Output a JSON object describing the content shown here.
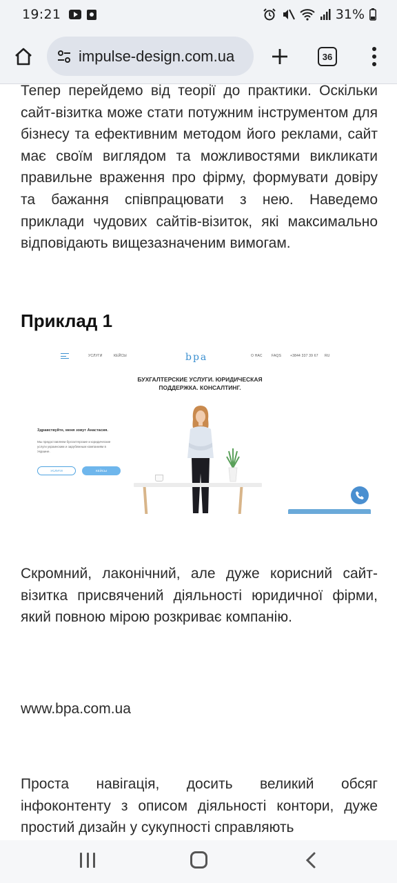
{
  "status_bar": {
    "time": "19:21",
    "battery": "31%"
  },
  "browser": {
    "url": "impulse-design.com.ua",
    "tab_count": "36"
  },
  "article": {
    "paragraph_intro": "Тепер перейдемо від теорії до практики. Оскільки сайт-візитка може стати потужним інструментом для бізнесу та ефективним методом його реклами, сайт має своїм виглядом та можливостями викликати правильне враження про фірму, формувати довіру та бажання співпрацювати з нею. Наведемо приклади чудових сайтів-візиток, які максимально відповідають вищезазначеним вимогам.",
    "heading": "Приклад 1",
    "example_shot": {
      "nav_services": "УСЛУГИ",
      "nav_cases": "КЕЙСЫ",
      "logo": "bpa",
      "nav_about": "О НАС",
      "nav_faqs": "FAQS",
      "phone": "+3844 337 39 67",
      "lang": "RU",
      "title": "БУХГАЛТЕРСКИЕ УСЛУГИ. ЮРИДИЧЕСКАЯ ПОДДЕРЖКА. КОНСАЛТИНГ.",
      "greeting": "Здравствуйте, меня зовут Анастасия.",
      "description": "Мы предоставляем бухгалтерские и юридические услуги украинским и зарубежным компаниям в Украине.",
      "button_services": "УСЛУГИ",
      "button_cases": "КЕЙСЫ"
    },
    "paragraph_desc": "Скромний, лаконічний, але дуже корисний сайт-візитка присвячений діяльності юридичної фірми, який повною мірою розкриває компанію.",
    "site_link": "www.bpa.com.ua",
    "paragraph_next": "Проста навігація, досить великий обсяг інфоконтенту з описом діяльності контори, дуже простий дизайн у сукупності справляють"
  },
  "colors": {
    "chrome_bg": "#f1f3f6",
    "url_pill": "#dfe3eb",
    "shot_accent": "#3a8fd0"
  },
  "icons": {
    "home": "home-icon",
    "site_settings": "tune-icon",
    "new_tab": "plus-icon",
    "menu": "more-vert-icon"
  }
}
